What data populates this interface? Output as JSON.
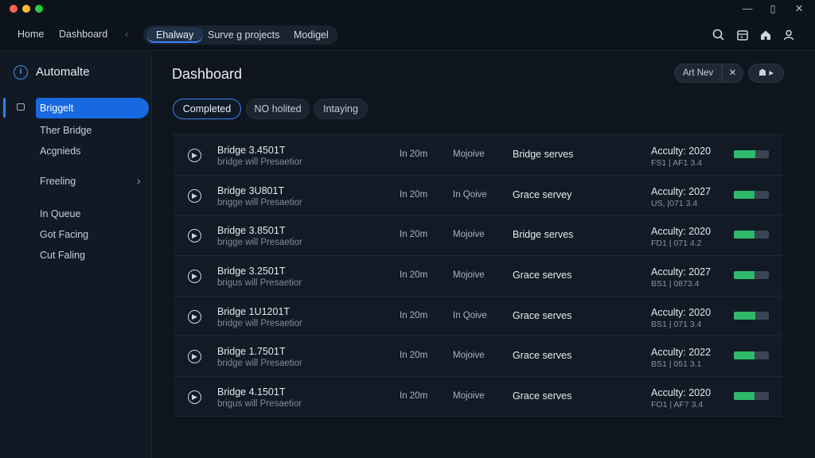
{
  "nav": {
    "links": [
      "Home",
      "Dashboard"
    ],
    "separator": "‹",
    "tabs": [
      {
        "label": "Ehalway",
        "active": true
      },
      {
        "label": "Surve g projects",
        "active": false
      },
      {
        "label": "Modigel",
        "active": false
      }
    ],
    "icons": [
      "search-icon",
      "calendar-icon",
      "home-icon",
      "user-icon"
    ]
  },
  "window_controls": [
    "—",
    "▯",
    "✕"
  ],
  "sidebar": {
    "brand": "Automalte",
    "items": [
      {
        "label": "Briggelt",
        "active": true
      },
      {
        "label": "Ther Bridge"
      },
      {
        "label": "Acgnieds"
      },
      {
        "label": "Freeling",
        "chevron": "›"
      },
      {
        "label": "In Queue"
      },
      {
        "label": "Got Facing"
      },
      {
        "label": "Cut Faling"
      }
    ]
  },
  "main": {
    "title": "Dashboard",
    "actions": {
      "art_nev": "Art Nev",
      "close": "✕",
      "extra": "☗ ▸"
    },
    "filters": [
      {
        "label": "Completed",
        "active": true
      },
      {
        "label": "NO holited",
        "active": false
      },
      {
        "label": "Intaying",
        "active": false
      }
    ]
  },
  "rows": [
    {
      "title": "Bridge 3.4501T",
      "subtitle": "bridge will Presaetior",
      "duration": "In 20m",
      "queue": "Mojoive",
      "service": "Bridge serves",
      "activity": "Acculty: 2020",
      "code": "FS1 | AF1 3.4",
      "progress": 0.62
    },
    {
      "title": "Bridge 3U801T",
      "subtitle": "brigge will Presaetior",
      "duration": "In 20m",
      "queue": "In Qoive",
      "service": "Grace servey",
      "activity": "Acculty: 2027",
      "code": "US, |071 3.4",
      "progress": 0.6
    },
    {
      "title": "Bridge 3.8501T",
      "subtitle": "brigge will Presaetior",
      "duration": "In 20m",
      "queue": "Mojoive",
      "service": "Bridge serves",
      "activity": "Acculty: 2020",
      "code": "FD1 | 071 4.2",
      "progress": 0.58
    },
    {
      "title": "Bridge 3.2501T",
      "subtitle": "brigus will Presaetior",
      "duration": "In 20m",
      "queue": "Mojoive",
      "service": "Grace serves",
      "activity": "Acculty: 2027",
      "code": "BS1 | 0873.4",
      "progress": 0.6
    },
    {
      "title": "Bridge 1U1201T",
      "subtitle": "bridge will Presaetior",
      "duration": "In 20m",
      "queue": "In Qoive",
      "service": "Grace serves",
      "activity": "Acculty: 2020",
      "code": "BS1 | 071 3.4",
      "progress": 0.62
    },
    {
      "title": "Bridge 1.7501T",
      "subtitle": "bridge will Presaetior",
      "duration": "In 20m",
      "queue": "Mojoive",
      "service": "Grace serves",
      "activity": "Acculty: 2022",
      "code": "BS1 | 051 3.1",
      "progress": 0.6
    },
    {
      "title": "Bridge 4.1501T",
      "subtitle": "brigus will Presaetior",
      "duration": "In 20m",
      "queue": "Mojoive",
      "service": "Grace serves",
      "activity": "Acculty: 2020",
      "code": "FO1 | AF7 3.4",
      "progress": 0.6
    }
  ],
  "colors": {
    "accent": "#1669e0",
    "progress": "#2fb96a",
    "background": "#0f151d"
  }
}
